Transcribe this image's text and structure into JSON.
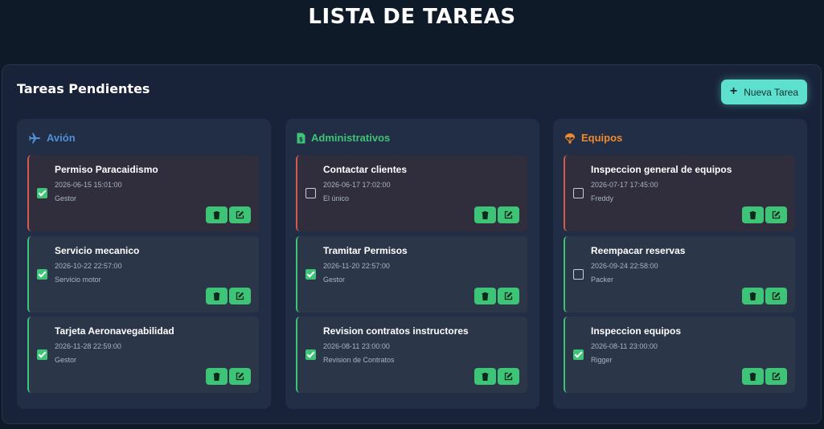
{
  "page_title": "LISTA DE TAREAS",
  "board": {
    "title": "Tareas Pendientes",
    "new_task_label": "Nueva Tarea"
  },
  "colors": {
    "accent": "#5ee0cf",
    "done_green": "#3ec476",
    "overdue_red": "#d35a4d",
    "avion": "#4f8fd6",
    "administrativos": "#3ec476",
    "equipos": "#f08a2e"
  },
  "columns": [
    {
      "name": "Avión",
      "icon": "plane-icon",
      "tasks": [
        {
          "title": "Permiso Paracaidismo",
          "datetime": "2026-06-15 15:01:00",
          "description": "Gestor",
          "done": true,
          "overdue": true
        },
        {
          "title": "Servicio mecanico",
          "datetime": "2026-10-22 22:57:00",
          "description": "Servicio motor",
          "done": true,
          "overdue": false
        },
        {
          "title": "Tarjeta Aeronavegabilidad",
          "datetime": "2026-11-28 22:59:00",
          "description": "Gestor",
          "done": true,
          "overdue": false
        }
      ]
    },
    {
      "name": "Administrativos",
      "icon": "invoice-icon",
      "tasks": [
        {
          "title": "Contactar clientes",
          "datetime": "2026-06-17 17:02:00",
          "description": "El único",
          "done": false,
          "overdue": true
        },
        {
          "title": "Tramitar Permisos",
          "datetime": "2026-11-20 22:57:00",
          "description": "Gestor",
          "done": true,
          "overdue": false
        },
        {
          "title": "Revision contratos instructores",
          "datetime": "2026-08-11 23:00:00",
          "description": "Revision de Contratos",
          "done": true,
          "overdue": false
        }
      ]
    },
    {
      "name": "Equipos",
      "icon": "parachute-icon",
      "tasks": [
        {
          "title": "Inspeccion general de equipos",
          "datetime": "2026-07-17 17:45:00",
          "description": "Freddy",
          "done": false,
          "overdue": true
        },
        {
          "title": "Reempacar reservas",
          "datetime": "2026-09-24 22:58:00",
          "description": "Packer",
          "done": false,
          "overdue": false
        },
        {
          "title": "Inspeccion equipos",
          "datetime": "2026-08-11 23:00:00",
          "description": "Rigger",
          "done": true,
          "overdue": false
        }
      ]
    }
  ]
}
